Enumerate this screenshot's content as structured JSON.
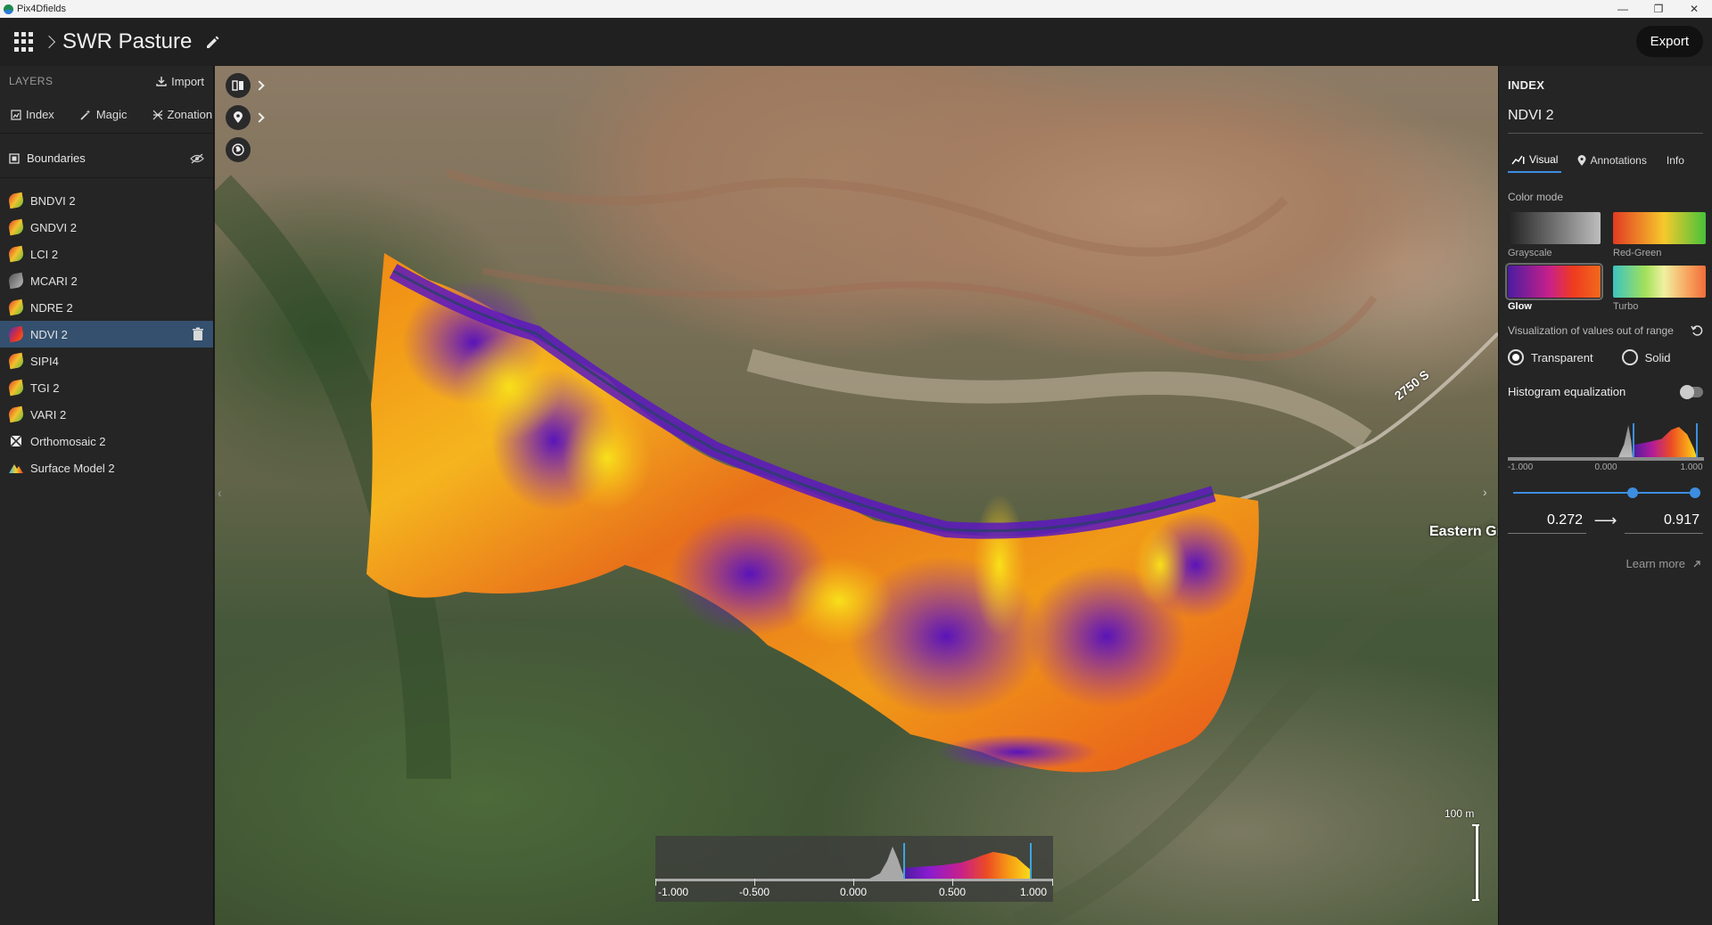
{
  "window": {
    "title": "Pix4Dfields"
  },
  "header": {
    "project_title": "SWR Pasture",
    "export_label": "Export"
  },
  "sidebar": {
    "layers_label": "LAYERS",
    "import_label": "Import",
    "tools": {
      "index": "Index",
      "magic": "Magic",
      "zonation": "Zonation"
    },
    "boundaries_label": "Boundaries",
    "layers": [
      {
        "label": "BNDVI 2",
        "icon": "leaf-icon"
      },
      {
        "label": "GNDVI 2",
        "icon": "leaf-icon"
      },
      {
        "label": "LCI 2",
        "icon": "leaf-icon"
      },
      {
        "label": "MCARI 2",
        "icon": "leaf-gray-icon"
      },
      {
        "label": "NDRE 2",
        "icon": "leaf-icon"
      },
      {
        "label": "NDVI 2",
        "icon": "leaf-glow-icon",
        "selected": true
      },
      {
        "label": "SIPI4",
        "icon": "leaf-icon"
      },
      {
        "label": "TGI 2",
        "icon": "leaf-icon"
      },
      {
        "label": "VARI 2",
        "icon": "leaf-icon"
      },
      {
        "label": "Orthomosaic 2",
        "icon": "orthomosaic-icon"
      },
      {
        "label": "Surface Model 2",
        "icon": "surface-model-icon"
      }
    ]
  },
  "map": {
    "road_label": "2750 S",
    "place_label": "Eastern Gr",
    "scale_label": "100 m",
    "legend_ticks": [
      "-1.000",
      "-0.500",
      "0.000",
      "0.500",
      "1.000"
    ]
  },
  "right_panel": {
    "title": "INDEX",
    "index_name": "NDVI 2",
    "tabs": {
      "visual": "Visual",
      "annotations": "Annotations",
      "info": "Info"
    },
    "color_mode_label": "Color mode",
    "swatches": {
      "grayscale": "Grayscale",
      "red_green": "Red-Green",
      "glow": "Glow",
      "turbo": "Turbo"
    },
    "selected_color_mode": "Glow",
    "out_of_range_label": "Visualization of values out of range",
    "radio": {
      "transparent": "Transparent",
      "solid": "Solid",
      "selected": "Transparent"
    },
    "histogram_eq_label": "Histogram equalization",
    "histogram_eq_on": false,
    "hist_labels": {
      "min": "-1.000",
      "mid": "0.000",
      "max": "1.000"
    },
    "range_min": "0.272",
    "range_max": "0.917",
    "learn_more": "Learn more"
  },
  "colors": {
    "accent": "#3d8ee0",
    "selected_row": "#34506e",
    "panel_bg": "#252525"
  }
}
